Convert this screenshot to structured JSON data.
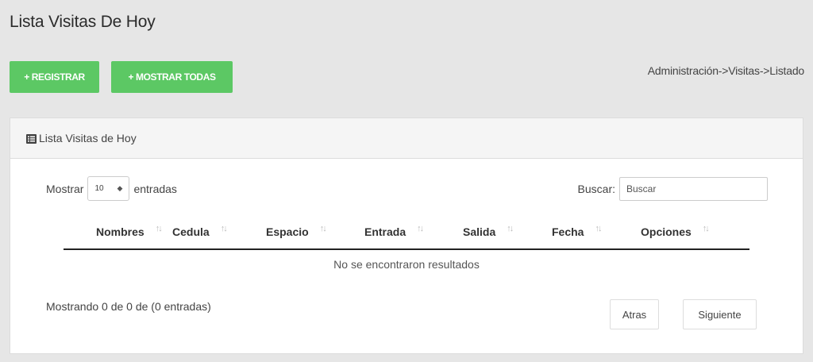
{
  "page": {
    "title": "Lista Visitas De Hoy"
  },
  "toolbar": {
    "register_label": "+ REGISTRAR",
    "show_all_label": "+ MOSTRAR TODAS"
  },
  "breadcrumb": "Administración->Visitas->Listado",
  "panel": {
    "heading": "Lista Visitas de Hoy",
    "heading_icon": "list-icon"
  },
  "table_controls": {
    "show_label": "Mostrar",
    "page_size": "10",
    "entries_label": "entradas",
    "search_label": "Buscar:",
    "search_placeholder": "Buscar"
  },
  "table": {
    "columns": [
      "Nombres",
      "Cedula",
      "Espacio",
      "Entrada",
      "Salida",
      "Fecha",
      "Opciones"
    ],
    "sort_icon": "sort-icon",
    "empty_message": "No se encontraron resultados"
  },
  "footer": {
    "info": "Mostrando 0 de 0 de (0 entradas)",
    "prev_label": "Atras",
    "next_label": "Siguiente"
  },
  "colors": {
    "accent_green": "#5cc864",
    "background": "#e6e6e6"
  }
}
